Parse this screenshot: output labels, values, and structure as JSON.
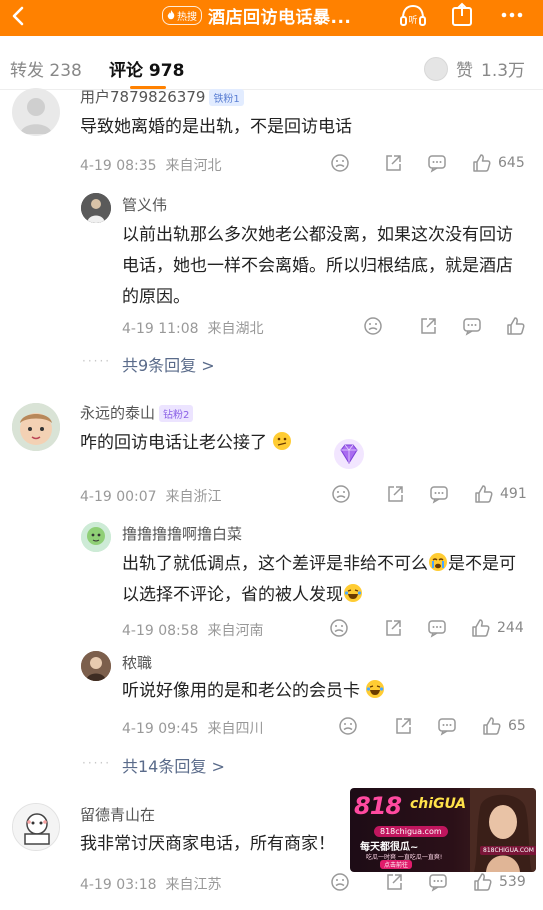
{
  "topbar": {
    "hot_label": "热搜",
    "title": "酒店回访电话暴...",
    "colors": {
      "bar": "#ff8100",
      "text": "#ffffff"
    },
    "icons": [
      "back-icon",
      "flame-icon",
      "listen-icon",
      "share-icon",
      "more-icon"
    ]
  },
  "tabs": {
    "repost_label": "转发",
    "repost_count": "238",
    "comment_label": "评论",
    "comment_count": "978",
    "like_label": "赞",
    "like_count": "1.3万",
    "accent": "#ff8100"
  },
  "comments": [
    {
      "user": "用户7879826379",
      "badge": "铁粉1",
      "text": "导致她离婚的是出轨，不是回访电话",
      "time": "4-19 08:35",
      "location": "来自河北",
      "likes": "645",
      "replies": [
        {
          "user": "管义伟",
          "text": "以前出轨那么多次她老公都没离，如果这次没有回访电话，她也一样不会离婚。所以归根结底，就是酒店的原因。",
          "time": "4-19 11:08",
          "location": "来自湖北"
        }
      ],
      "more_replies": "共9条回复 >"
    },
    {
      "user": "永远的泰山",
      "badge": "钻粉2",
      "text": "咋的回访电话让老公接了",
      "time": "4-19 00:07",
      "location": "来自浙江",
      "likes": "491",
      "replies": [
        {
          "user": "撸撸撸撸啊撸白菜",
          "text": "出轨了就低调点，这个差评是非给不可么",
          "text2": "是不是可以选择不评论，省的被人发现",
          "time": "4-19 08:58",
          "location": "来自河南",
          "likes": "244"
        },
        {
          "user": "秾職",
          "text": "听说好像用的是和老公的会员卡",
          "time": "4-19 09:45",
          "location": "来自四川",
          "likes": "65"
        }
      ],
      "more_replies": "共14条回复 >"
    },
    {
      "user": "留德青山在",
      "text": "我非常讨厌商家电话，所有商家！",
      "time": "4-19 03:18",
      "location": "来自江苏",
      "likes": "539"
    }
  ],
  "ad": {
    "logo": "818",
    "logo_sub": "chiGUA",
    "site": "818chigua.com",
    "slogan": "每天都很瓜~",
    "mini": "吃瓜一时爽 一直吃瓜一直爽!",
    "button": "点击前往",
    "tag": "818CHIGUA.COM"
  }
}
